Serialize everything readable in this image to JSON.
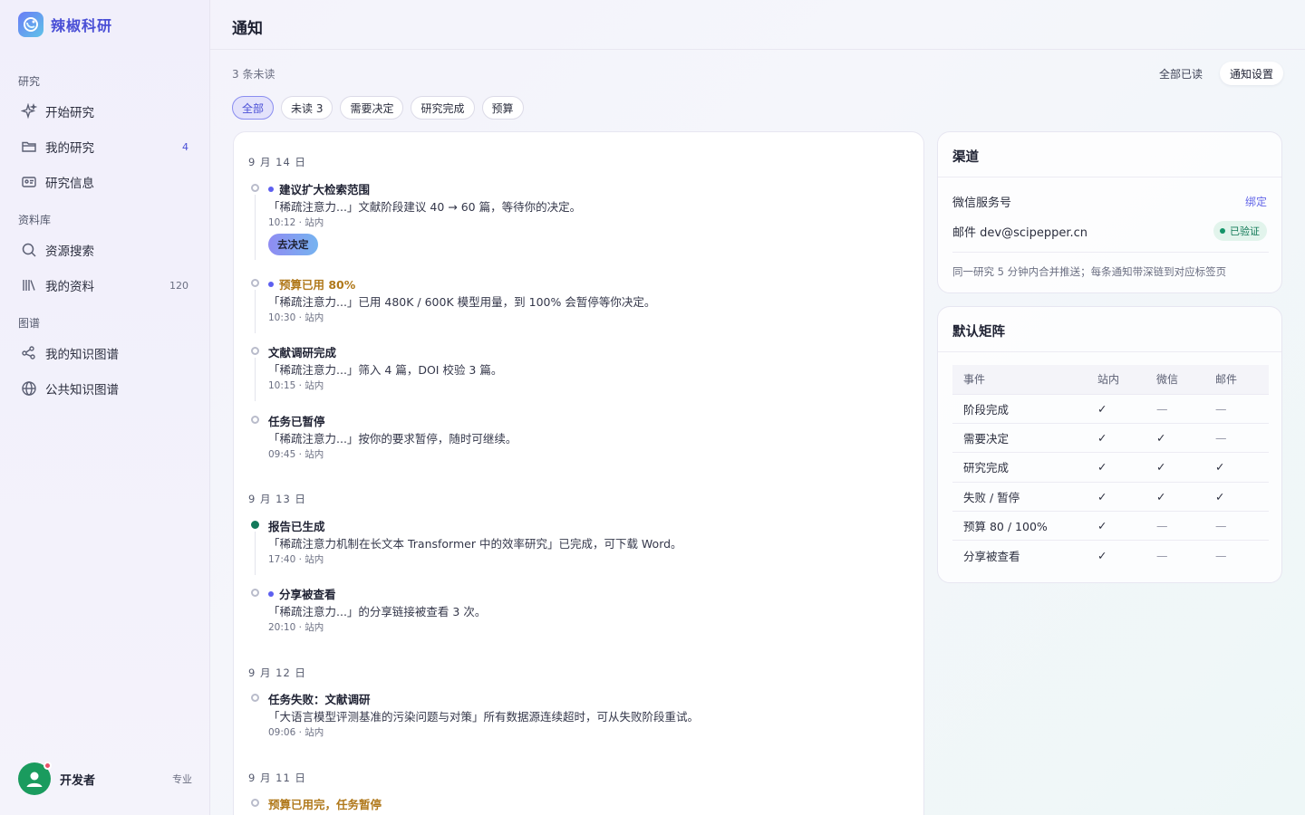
{
  "brand": {
    "name": "辣椒科研"
  },
  "sidebar": {
    "sections": [
      {
        "label": "研究"
      },
      {
        "label": "资料库"
      },
      {
        "label": "图谱"
      }
    ],
    "items": [
      {
        "label": "开始研究",
        "icon": "sparkles-icon"
      },
      {
        "label": "我的研究",
        "icon": "folder-icon",
        "count": "4"
      },
      {
        "label": "研究信息",
        "icon": "id-card-icon"
      },
      {
        "label": "资源搜索",
        "icon": "search-icon"
      },
      {
        "label": "我的资料",
        "icon": "library-icon",
        "count": "120"
      },
      {
        "label": "我的知识图谱",
        "icon": "graph-icon"
      },
      {
        "label": "公共知识图谱",
        "icon": "globe-icon"
      }
    ],
    "user": {
      "name": "开发者",
      "plan": "专业"
    }
  },
  "header": {
    "title": "通知",
    "unread_summary": "3 条未读",
    "mark_all_read": "全部已读",
    "settings": "通知设置"
  },
  "filters": [
    {
      "label": "全部",
      "active": true
    },
    {
      "label": "未读 3"
    },
    {
      "label": "需要决定"
    },
    {
      "label": "研究完成"
    },
    {
      "label": "预算"
    }
  ],
  "feed": {
    "days": [
      {
        "label": "9 月 14 日"
      },
      {
        "label": "9 月 13 日"
      },
      {
        "label": "9 月 12 日"
      },
      {
        "label": "9 月 11 日"
      }
    ],
    "items": [
      {
        "title": "建议扩大检索范围",
        "desc": "「稀疏注意力...」文献阶段建议 40 → 60 篇，等待你的决定。",
        "meta": "10:12 · 站内",
        "unread": true,
        "action": "去决定"
      },
      {
        "title": "预算已用 80%",
        "desc": "「稀疏注意力...」已用 480K / 600K 模型用量，到 100% 会暂停等你决定。",
        "meta": "10:30 · 站内",
        "unread": true,
        "warn": true
      },
      {
        "title": "文献调研完成",
        "desc": "「稀疏注意力...」筛入 4 篇，DOI 校验 3 篇。",
        "meta": "10:15 · 站内"
      },
      {
        "title": "任务已暂停",
        "desc": "「稀疏注意力...」按你的要求暂停，随时可继续。",
        "meta": "09:45 · 站内"
      },
      {
        "title": "报告已生成",
        "desc": "「稀疏注意力机制在长文本 Transformer 中的效率研究」已完成，可下载 Word。",
        "meta": "17:40 · 站内",
        "filled": true
      },
      {
        "title": "分享被查看",
        "desc": "「稀疏注意力...」的分享链接被查看 3 次。",
        "meta": "20:10 · 站内",
        "unread": true
      },
      {
        "title": "任务失败：文献调研",
        "desc": "「大语言模型评测基准的污染问题与对策」所有数据源连续超时，可从失败阶段重试。",
        "meta": "09:06 · 站内"
      },
      {
        "title": "预算已用完，任务暂停",
        "desc": "",
        "meta": "",
        "warn": true
      }
    ]
  },
  "channels": {
    "title": "渠道",
    "wechat_label": "微信服务号",
    "wechat_action": "绑定",
    "email_label": "邮件 dev@scipepper.cn",
    "email_status": "已验证",
    "note": "同一研究 5 分钟内合并推送；每条通知带深链到对应标签页"
  },
  "matrix": {
    "title": "默认矩阵",
    "headers": [
      "事件",
      "站内",
      "微信",
      "邮件"
    ],
    "rows": [
      {
        "event": "阶段完成",
        "cells": [
          "✓",
          "—",
          "—"
        ]
      },
      {
        "event": "需要决定",
        "cells": [
          "✓",
          "✓",
          "—"
        ]
      },
      {
        "event": "研究完成",
        "cells": [
          "✓",
          "✓",
          "✓"
        ]
      },
      {
        "event": "失败 / 暂停",
        "cells": [
          "✓",
          "✓",
          "✓"
        ]
      },
      {
        "event": "预算 80 / 100%",
        "cells": [
          "✓",
          "—",
          "—"
        ]
      },
      {
        "event": "分享被查看",
        "cells": [
          "✓",
          "—",
          "—"
        ]
      }
    ]
  },
  "colors": {
    "accent": "#4a4fd6",
    "unread": "#5d5ff0",
    "warn": "#b0781a",
    "success": "#12795a"
  }
}
